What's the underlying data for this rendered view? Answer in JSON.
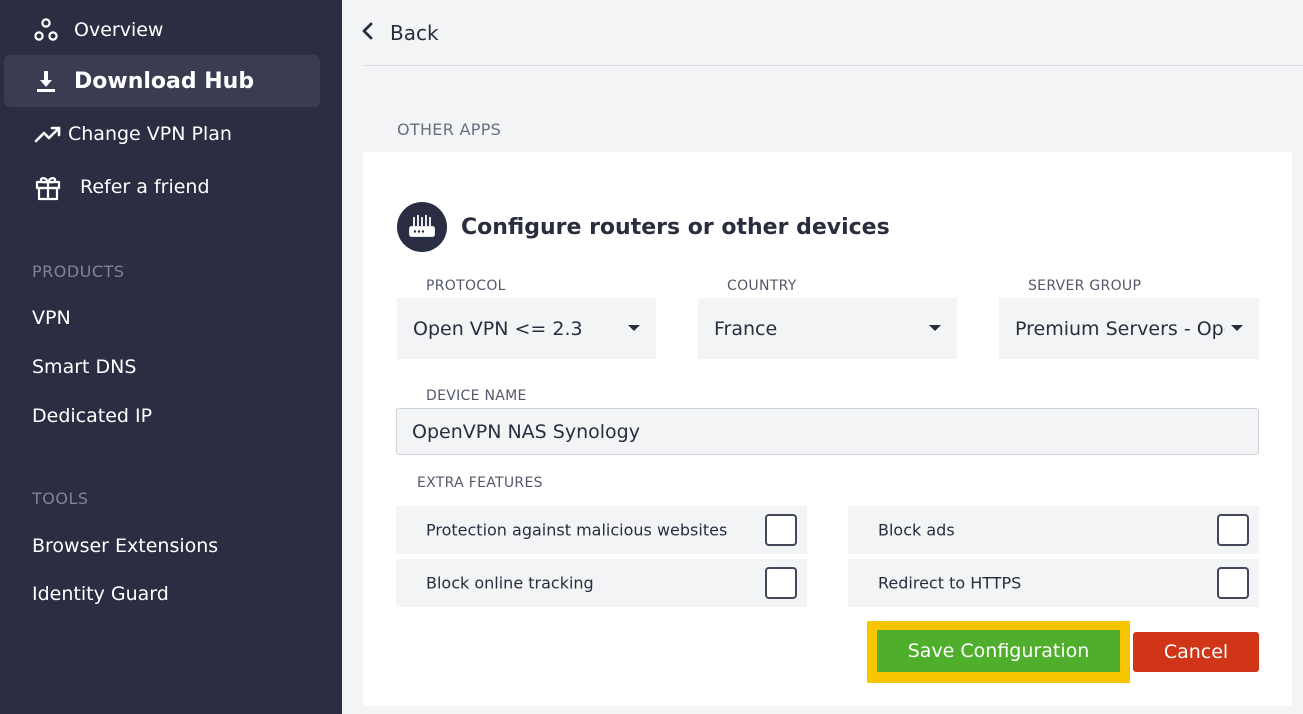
{
  "sidebar": {
    "nav": [
      {
        "label": "Overview",
        "icon": "overview-icon",
        "active": false
      },
      {
        "label": "Download Hub",
        "icon": "download-icon",
        "active": true
      },
      {
        "label": "Change VPN Plan",
        "icon": "trending-up-icon",
        "active": false
      },
      {
        "label": "Refer a friend",
        "icon": "gift-icon",
        "active": false
      }
    ],
    "products_title": "PRODUCTS",
    "products": [
      "VPN",
      "Smart DNS",
      "Dedicated IP"
    ],
    "tools_title": "TOOLS",
    "tools": [
      "Browser Extensions",
      "Identity Guard"
    ]
  },
  "topbar": {
    "back_label": "Back"
  },
  "section_label": "OTHER APPS",
  "card": {
    "title": "Configure routers or other devices",
    "protocol": {
      "label": "PROTOCOL",
      "value": "Open VPN <= 2.3"
    },
    "country": {
      "label": "COUNTRY",
      "value": "France"
    },
    "server_group": {
      "label": "SERVER GROUP",
      "value": "Premium Servers - OpenVPN"
    },
    "device_name": {
      "label": "DEVICE NAME",
      "value": "OpenVPN NAS Synology"
    },
    "extra_features": {
      "label": "EXTRA FEATURES",
      "items": [
        {
          "label": "Protection against malicious websites",
          "checked": false
        },
        {
          "label": "Block ads",
          "checked": false
        },
        {
          "label": "Block online tracking",
          "checked": false
        },
        {
          "label": "Redirect to HTTPS",
          "checked": false
        }
      ]
    },
    "save_label": "Save Configuration",
    "cancel_label": "Cancel"
  },
  "colors": {
    "sidebar_bg": "#2b2d42",
    "save_green": "#4fae2b",
    "cancel_red": "#cf3516",
    "highlight_yellow": "#f7c600"
  }
}
